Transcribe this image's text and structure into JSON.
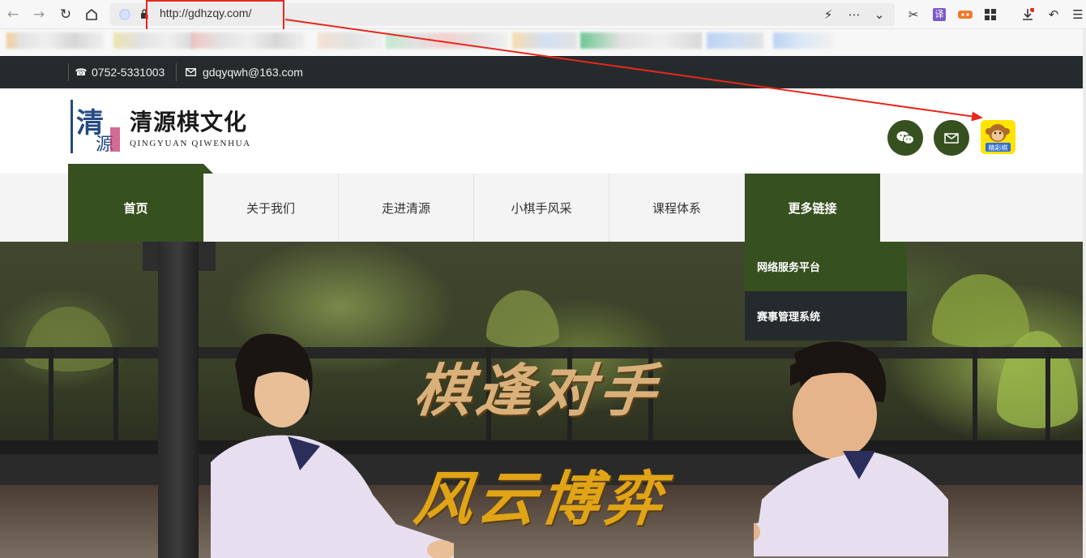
{
  "browser": {
    "url": "http://gdhzqy.com/",
    "toolbar_icons": [
      "back-icon",
      "forward-icon",
      "reload-icon",
      "home-icon",
      "lightning-icon",
      "more-icon",
      "chevron-down-icon",
      "scissors-icon",
      "translate-icon",
      "game-icon",
      "apps-icon",
      "download-icon",
      "undo-icon",
      "menu-icon"
    ],
    "translate_label": "译",
    "bookmarks_blurred": true
  },
  "topbar": {
    "phone": "0752-5331003",
    "email": "gdqyqwh@163.com"
  },
  "header": {
    "logo_title": "清源棋文化",
    "logo_subtitle": "QINGYUAN QIWENHUA",
    "logo_mark": "清源",
    "social_icons": [
      "wechat-icon",
      "mail-icon"
    ],
    "badge_text": "精彩棋"
  },
  "nav": {
    "items": [
      {
        "label": "首页",
        "active": true
      },
      {
        "label": "关于我们",
        "active": false
      },
      {
        "label": "走进清源",
        "active": false
      },
      {
        "label": "小棋手风采",
        "active": false
      },
      {
        "label": "课程体系",
        "active": false
      },
      {
        "label": "更多链接",
        "active": true
      }
    ],
    "dropdown": [
      "网络服务平台",
      "赛事管理系统"
    ]
  },
  "hero": {
    "line1": "棋逢对手",
    "line2": "风云博弈"
  },
  "colors": {
    "primary_green": "#37501f",
    "topbar_dark": "#252b2d",
    "annotation_red": "#e8271b",
    "hero_gold": "#e0a416"
  }
}
